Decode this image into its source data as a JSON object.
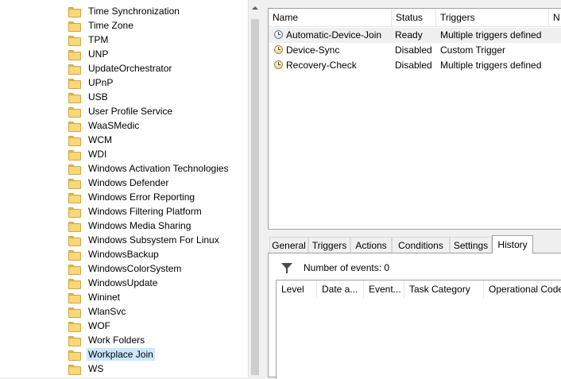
{
  "tree": {
    "items": [
      "Time Synchronization",
      "Time Zone",
      "TPM",
      "UNP",
      "UpdateOrchestrator",
      "UPnP",
      "USB",
      "User Profile Service",
      "WaaSMedic",
      "WCM",
      "WDI",
      "Windows Activation Technologies",
      "Windows Defender",
      "Windows Error Reporting",
      "Windows Filtering Platform",
      "Windows Media Sharing",
      "Windows Subsystem For Linux",
      "WindowsBackup",
      "WindowsColorSystem",
      "WindowsUpdate",
      "Wininet",
      "WlanSvc",
      "WOF",
      "Work Folders",
      "Workplace Join",
      "WS"
    ],
    "selected": "Workplace Join",
    "icon": "folder-icon"
  },
  "tasks": {
    "columns": [
      "Name",
      "Status",
      "Triggers",
      "N"
    ],
    "rows": [
      {
        "name": "Automatic-Device-Join",
        "status": "Ready",
        "triggers": "Multiple triggers defined",
        "icon": "clock-icon"
      },
      {
        "name": "Device-Sync",
        "status": "Disabled",
        "triggers": "Custom Trigger",
        "icon": "clock-disabled-icon"
      },
      {
        "name": "Recovery-Check",
        "status": "Disabled",
        "triggers": "Multiple triggers defined",
        "icon": "clock-disabled-icon"
      }
    ]
  },
  "tabs": {
    "labels": [
      "General",
      "Triggers",
      "Actions",
      "Conditions",
      "Settings",
      "History"
    ],
    "active": "History"
  },
  "history": {
    "event_count_label": "Number of events: 0",
    "columns": [
      "Level",
      "Date a...",
      "Event...",
      "Task Category",
      "Operational Code"
    ],
    "filter_icon": "filter-icon"
  },
  "colors": {
    "selection": "#cce8ff",
    "folder": "#f8d878",
    "border": "#a0a0a0"
  }
}
